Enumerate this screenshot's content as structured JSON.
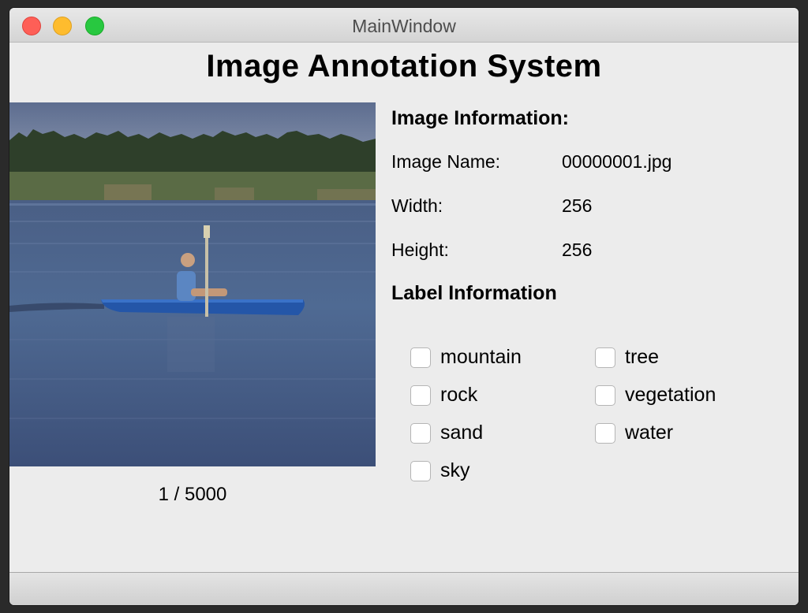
{
  "window": {
    "title": "MainWindow"
  },
  "app": {
    "title": "Image Annotation System"
  },
  "image": {
    "icon": "photo-kayaker-on-lake",
    "counter": "1 / 5000"
  },
  "image_info": {
    "heading": "Image Information:",
    "name_label": "Image Name:",
    "name_value": "00000001.jpg",
    "width_label": "Width:",
    "width_value": "256",
    "height_label": "Height:",
    "height_value": "256"
  },
  "labels": {
    "heading": "Label Information",
    "items": [
      {
        "label": "mountain",
        "checked": false
      },
      {
        "label": "tree",
        "checked": false
      },
      {
        "label": "rock",
        "checked": false
      },
      {
        "label": "vegetation",
        "checked": false
      },
      {
        "label": "sand",
        "checked": false
      },
      {
        "label": "water",
        "checked": false
      },
      {
        "label": "sky",
        "checked": false
      }
    ]
  },
  "colors": {
    "close": "#fe5f57",
    "minimize": "#febc2e",
    "maximize": "#28c840",
    "window_bg": "#ececec"
  }
}
